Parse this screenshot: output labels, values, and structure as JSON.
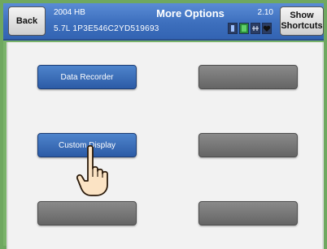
{
  "header": {
    "back_label": "Back",
    "vehicle_year": "2004 HB",
    "vehicle_vin": "5.7L   1P3E546C2YD519693",
    "title": "More Options",
    "version": "2.10",
    "shortcuts_line1": "Show",
    "shortcuts_line2": "Shortcuts",
    "status_icons": [
      "battery-icon",
      "signal-icon",
      "connection-icon",
      "heart-icon"
    ],
    "status_colors": [
      "#2b3d63",
      "#2a8a3a",
      "#2b3d63",
      "#2b3d63"
    ]
  },
  "options": {
    "data_recorder": "Data Recorder",
    "custom_display": "Custom Display"
  },
  "colors": {
    "header_blue": "#3d6fbd",
    "button_blue": "#3b6fbb",
    "button_gray": "#777777",
    "frame_green": "#7ab36a"
  },
  "pointer": "pointing-hand-icon"
}
